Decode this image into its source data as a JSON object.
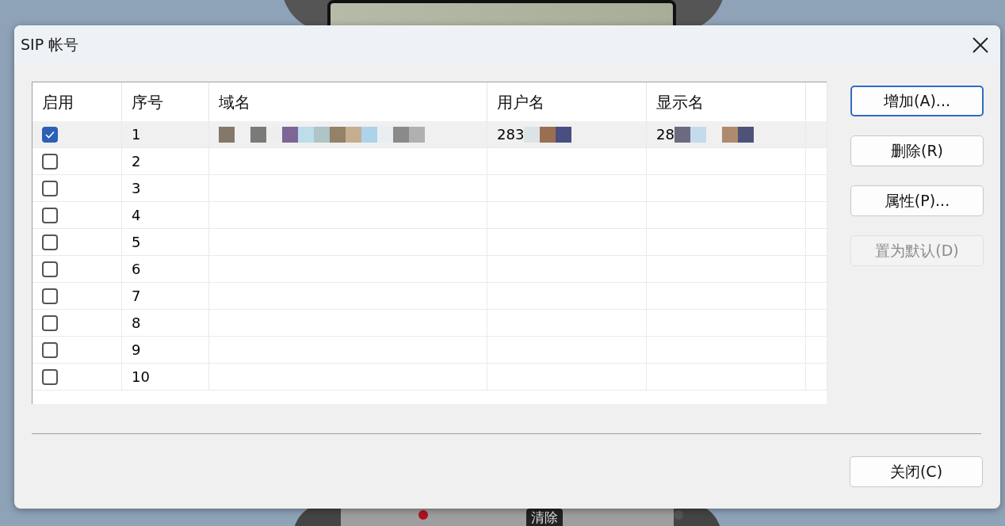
{
  "background_app": {
    "key_label": "清除"
  },
  "dialog": {
    "title": "SIP 帐号"
  },
  "table": {
    "columns": [
      "启用",
      "序号",
      "域名",
      "用户名",
      "显示名"
    ],
    "rows": [
      {
        "enabled": true,
        "selected": true,
        "index": "1",
        "user_name": "283",
        "display_name": "28",
        "redacted": true
      },
      {
        "enabled": false,
        "selected": false,
        "index": "2"
      },
      {
        "enabled": false,
        "selected": false,
        "index": "3"
      },
      {
        "enabled": false,
        "selected": false,
        "index": "4"
      },
      {
        "enabled": false,
        "selected": false,
        "index": "5"
      },
      {
        "enabled": false,
        "selected": false,
        "index": "6"
      },
      {
        "enabled": false,
        "selected": false,
        "index": "7"
      },
      {
        "enabled": false,
        "selected": false,
        "index": "8"
      },
      {
        "enabled": false,
        "selected": false,
        "index": "9"
      },
      {
        "enabled": false,
        "selected": false,
        "index": "10"
      }
    ]
  },
  "buttons": [
    {
      "label": "增加(A)...",
      "disabled": false,
      "focused": true
    },
    {
      "label": "删除(R)",
      "disabled": false,
      "focused": false
    },
    {
      "label": "属性(P)...",
      "disabled": false,
      "focused": false
    },
    {
      "label": "置为默认(D)",
      "disabled": true,
      "focused": false
    }
  ],
  "close_button": {
    "label": "关闭(C)"
  }
}
